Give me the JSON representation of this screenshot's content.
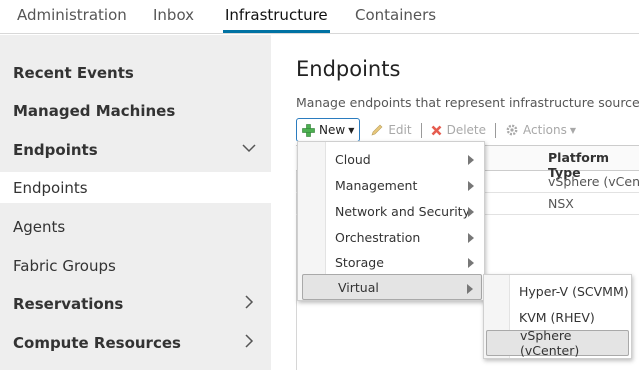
{
  "top_tabs": [
    {
      "label": "Administration",
      "active": false
    },
    {
      "label": "Inbox",
      "active": false
    },
    {
      "label": "Infrastructure",
      "active": true
    },
    {
      "label": "Containers",
      "active": false
    }
  ],
  "sidebar": {
    "items": [
      {
        "label": "Recent Events",
        "bold": true
      },
      {
        "label": "Managed Machines",
        "bold": true
      },
      {
        "label": "Endpoints",
        "bold": true,
        "expander": "chevron-down-icon"
      },
      {
        "label": "Endpoints",
        "bold": false,
        "selected": true
      },
      {
        "label": "Agents",
        "bold": false
      },
      {
        "label": "Fabric Groups",
        "bold": false
      },
      {
        "label": "Reservations",
        "bold": true,
        "expander": "chevron-right-icon"
      },
      {
        "label": "Compute Resources",
        "bold": true,
        "expander": "chevron-right-icon"
      }
    ]
  },
  "main": {
    "title": "Endpoints",
    "subtitle": "Manage endpoints that represent infrastructure sources",
    "toolbar": {
      "new_label": "New",
      "edit_label": "Edit",
      "delete_label": "Delete",
      "actions_label": "Actions"
    },
    "table": {
      "columns": [
        "Platform Type"
      ],
      "rows": [
        [
          "vSphere (vCenter)"
        ],
        [
          "NSX"
        ]
      ]
    }
  },
  "new_menu": {
    "items": [
      {
        "label": "Cloud",
        "has_submenu": true
      },
      {
        "label": "Management",
        "has_submenu": true
      },
      {
        "label": "Network and Security",
        "has_submenu": true
      },
      {
        "label": "Orchestration",
        "has_submenu": true
      },
      {
        "label": "Storage",
        "has_submenu": true
      },
      {
        "label": "Virtual",
        "has_submenu": true,
        "highlighted": true
      }
    ],
    "virtual_submenu": [
      {
        "label": "Hyper-V (SCVMM)"
      },
      {
        "label": "KVM (RHEV)"
      },
      {
        "label": "vSphere (vCenter)",
        "highlighted": true
      }
    ]
  },
  "colors": {
    "accent": "#0072a3",
    "sidebar_bg": "#eeeeee",
    "new_button_border": "#2b7cbf",
    "plus_icon": "#4caf50",
    "delete_icon": "#e65c4f"
  }
}
